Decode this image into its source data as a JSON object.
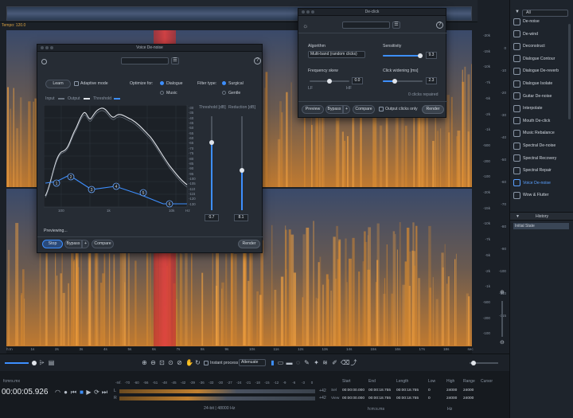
{
  "app": {
    "tempo_label": "Tempo: 120.0"
  },
  "sidebar": {
    "filter_value": "All",
    "tools": [
      {
        "label": "De-noise",
        "selected": false
      },
      {
        "label": "De-wind",
        "selected": false
      },
      {
        "label": "Deconstruct",
        "selected": false
      },
      {
        "label": "Dialogue Contour",
        "selected": false
      },
      {
        "label": "Dialogue De-reverb",
        "selected": false
      },
      {
        "label": "Dialogue Isolate",
        "selected": false
      },
      {
        "label": "Guitar De-noise",
        "selected": false
      },
      {
        "label": "Interpolate",
        "selected": false
      },
      {
        "label": "Mouth De-click",
        "selected": false
      },
      {
        "label": "Music Rebalance",
        "selected": false
      },
      {
        "label": "Spectral De-noise",
        "selected": false
      },
      {
        "label": "Spectral Recovery",
        "selected": false
      },
      {
        "label": "Spectral Repair",
        "selected": false
      },
      {
        "label": "Voice De-noise",
        "selected": true
      },
      {
        "label": "Wow & Flutter",
        "selected": false
      }
    ],
    "history_title": "History",
    "history_items": [
      "Initial State"
    ]
  },
  "freq_axis": [
    "-20k",
    "-15k",
    "-10k",
    "-7k",
    "-5k",
    "-2k",
    "-1k",
    "-500",
    "-200",
    "-100",
    "-20k",
    "-15k",
    "-10k",
    "-7k",
    "-5k",
    "-2k",
    "-1k",
    "-500",
    "-200",
    "-100"
  ],
  "db_axis": [
    "0",
    "-10",
    "-20",
    "-30",
    "-40",
    "-50",
    "-60",
    "-70",
    "-80",
    "-90",
    "-100",
    "-110",
    "-115"
  ],
  "time_axis": [
    "h:m",
    "1s",
    "2s",
    "3s",
    "4s",
    "5s",
    "6s",
    "7s",
    "8s",
    "9s",
    "10s",
    "11s",
    "12s",
    "13s",
    "14s",
    "15s",
    "16s",
    "17s",
    "18s",
    "sec"
  ],
  "voice_denoise": {
    "title": "Voice De-noise",
    "learn_label": "Learn",
    "adaptive_label": "Adaptive mode",
    "optimize_label": "Optimize for:",
    "optimize_options": [
      "Dialogue",
      "Music"
    ],
    "optimize_selected": "Dialogue",
    "filter_label": "Filter type:",
    "filter_options": [
      "Surgical",
      "Gentle"
    ],
    "filter_selected": "Surgical",
    "legend": {
      "input": "Input",
      "output": "Output",
      "threshold": "Threshold"
    },
    "threshold_label": "Threshold [dB]",
    "reduction_label": "Reduction [dB]",
    "threshold_value": "0.7",
    "reduction_value": "8.1",
    "threshold_level": 0.72,
    "reduction_level": 0.42,
    "graph_db_ticks": [
      "-30",
      "-35",
      "-40",
      "-45",
      "-50",
      "-55",
      "-60",
      "-65",
      "-70",
      "-75",
      "-80",
      "-85",
      "-90",
      "-95",
      "-100",
      "-105",
      "-110",
      "-115",
      "-120",
      "-130"
    ],
    "graph_freq_ticks": [
      "100",
      "1k",
      "10k",
      "Hz"
    ],
    "nodes": [
      "1",
      "2",
      "3",
      "4",
      "5",
      "6"
    ],
    "status": "Previewing...",
    "stop_label": "Stop",
    "bypass_label": "Bypass",
    "compare_label": "Compare",
    "render_label": "Render"
  },
  "declick": {
    "title": "De-click",
    "algorithm_label": "Algorithm",
    "algorithm_value": "Multi-band (random clicks)",
    "sensitivity_label": "Sensitivity",
    "sensitivity_value": "9.3",
    "sensitivity_level": 0.93,
    "freq_skew_label": "Frequency skew",
    "freq_skew_value": "0.0",
    "freq_skew_level": 0.5,
    "lf_label": "LF",
    "hf_label": "HF",
    "click_widening_label": "Click widening [ms]",
    "click_widening_value": "2.3",
    "click_widening_level": 0.3,
    "clicks_repaired": "0 clicks repaired",
    "preview_label": "Preview",
    "bypass_label": "Bypass",
    "compare_label": "Compare",
    "output_clicks_label": "Output clicks only",
    "render_label": "Render"
  },
  "toolbar": {
    "instant_process_label": "Instant process",
    "attenuate_value": "Attenuate"
  },
  "transport": {
    "file_name": "fcmrs.mx",
    "time": "00:00:05.926",
    "meter_ticks": [
      "-Inf.",
      "-70",
      "-60",
      "-56",
      "-51",
      "-48",
      "-45",
      "-42",
      "-39",
      "-36",
      "-33",
      "-30",
      "-27",
      "-24",
      "-21",
      "-18",
      "-15",
      "-12",
      "-9",
      "-6",
      "-3",
      "0"
    ],
    "meter_l": "L",
    "meter_r": "R",
    "peak_l": "+42",
    "peak_r": "+42",
    "format": "24-bit | 48000 Hz"
  },
  "selection": {
    "headers": [
      "Start",
      "End",
      "Length",
      "Low",
      "High",
      "Range",
      "Cursor"
    ],
    "rows": [
      {
        "label": "Sel",
        "start": "00:00:00.000",
        "end": "00:00:18.755",
        "length": "00:00:18.755",
        "low": "0",
        "high": "24000",
        "range": "24000"
      },
      {
        "label": "View",
        "start": "00:00:00.000",
        "end": "00:00:18.755",
        "length": "00:00:18.755",
        "low": "0",
        "high": "24000",
        "range": "24000"
      }
    ],
    "timecode_unit": "h:m:s.ms",
    "hz_unit": "Hz"
  },
  "colors": {
    "accent": "#3d8fff",
    "highlight": "#e03030",
    "spectrum_hot": "#f0a040"
  }
}
